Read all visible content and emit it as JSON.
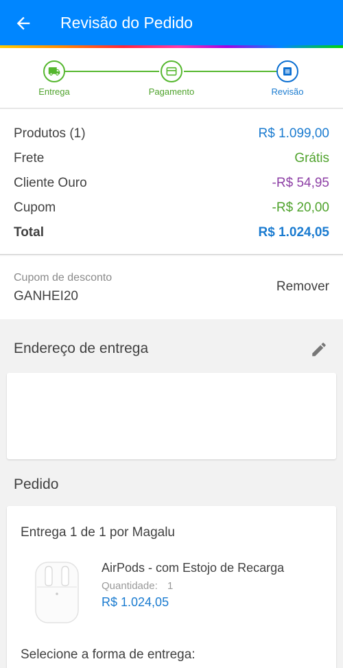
{
  "header": {
    "title": "Revisão do Pedido"
  },
  "stepper": {
    "steps": [
      {
        "label": "Entrega",
        "icon": "truck-icon"
      },
      {
        "label": "Pagamento",
        "icon": "card-icon"
      },
      {
        "label": "Revisão",
        "icon": "document-icon"
      }
    ],
    "colors": {
      "done": "#55b72e",
      "active": "#0a6ed1"
    }
  },
  "summary": {
    "rows": [
      {
        "label": "Produtos (1)",
        "value": "R$ 1.099,00",
        "color": "#1a7bd0"
      },
      {
        "label": "Frete",
        "value": "Grátis",
        "color": "#4ea22b"
      },
      {
        "label": "Cliente Ouro",
        "value": "-R$ 54,95",
        "color": "#8d3fa5"
      },
      {
        "label": "Cupom",
        "value": "-R$ 20,00",
        "color": "#4ea22b"
      },
      {
        "label": "Total",
        "value": "R$ 1.024,05",
        "color": "#1a7bd0"
      }
    ]
  },
  "coupon": {
    "caption": "Cupom de desconto",
    "code": "GANHEI20",
    "remove_label": "Remover"
  },
  "address": {
    "title": "Endereço de entrega"
  },
  "order": {
    "title": "Pedido",
    "delivery_label": "Entrega 1 de 1 por Magalu",
    "product": {
      "name": "AirPods - com Estojo de Recarga",
      "quantity_label": "Quantidade:",
      "quantity": "1",
      "price": "R$ 1.024,05"
    },
    "select_label": "Selecione a forma de entrega:"
  }
}
